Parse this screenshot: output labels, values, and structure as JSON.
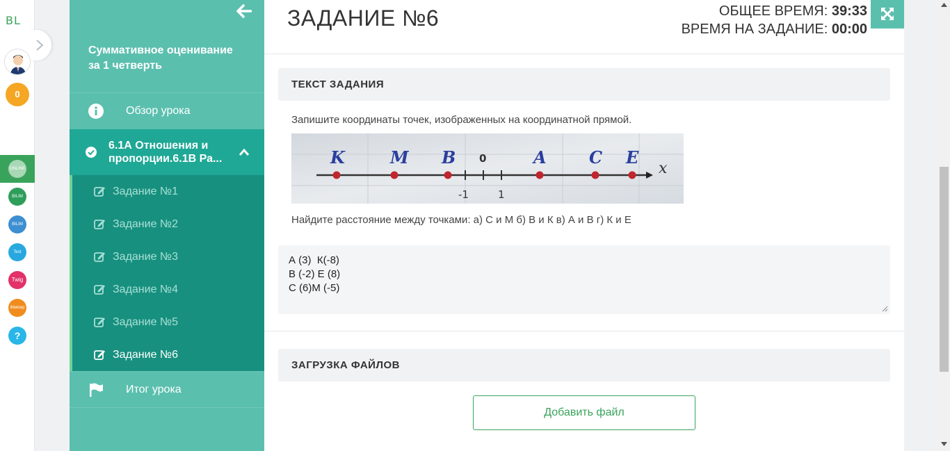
{
  "rail": {
    "logo": "BL",
    "coins": "0",
    "apps": [
      {
        "name": "online-mektep",
        "color": "#3aa35b",
        "label": "ONLINE MEKTEP"
      },
      {
        "name": "bilimland",
        "color": "#2e9e5b",
        "label": "BILIM Land"
      },
      {
        "name": "bilimbook",
        "color": "#3d8fd1",
        "label": "BILIM Book"
      },
      {
        "name": "test",
        "color": "#29a8e0",
        "label": "Test"
      },
      {
        "name": "twig",
        "color": "#e2316b",
        "label": "Twig"
      },
      {
        "name": "imektep",
        "color": "#f08c1e",
        "label": "iMektep"
      },
      {
        "name": "help",
        "color": "#29b6e8",
        "label": "?"
      }
    ]
  },
  "sidebar": {
    "course_title_line1": "Суммативное оценивание",
    "course_title_line2": "за 1 четверть",
    "overview": "Обзор урока",
    "lesson_line1": "6.1А Отношения и",
    "lesson_line2": "пропорции.6.1В Ра...",
    "tasks": [
      "Задание №1",
      "Задание №2",
      "Задание №3",
      "Задание №4",
      "Задание №5",
      "Задание №6"
    ],
    "summary": "Итог урока"
  },
  "main": {
    "title": "ЗАДАНИЕ №6",
    "total_time_label": "ОБЩЕЕ ВРЕМЯ:",
    "total_time_value": "39:33",
    "task_time_label": "ВРЕМЯ НА ЗАДАНИЕ:",
    "task_time_value": "00:00",
    "task_text_header": "ТЕКСТ ЗАДАНИЯ",
    "question_line1": "Запишите координаты точек, изображенных на координатной прямой.",
    "question_line2": "Найдите расстояние между точками: а) С и М б) В и К в) А и В г) К и Е",
    "number_line": {
      "point_labels": [
        "K",
        "M",
        "B",
        "0",
        "A",
        "C",
        "E",
        "x"
      ],
      "tick_labels": [
        "-1",
        "1"
      ]
    },
    "answer_lines": [
      "А (3)  К(-8)",
      "В (-2) Е (8)",
      "С (6)М (-5)"
    ],
    "upload_header": "ЗАГРУЗКА ФАЙЛОВ",
    "add_file": "Добавить файл"
  },
  "colors": {
    "sidebar": "#5bbfae",
    "lesson_active": "#1fa896",
    "tasks_bg": "#18907f",
    "accent_green": "#3aa35b"
  }
}
